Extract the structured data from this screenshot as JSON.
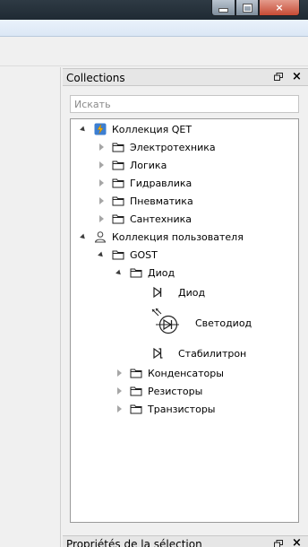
{
  "window": {
    "min_label": "",
    "max_label": "",
    "close_label": "×"
  },
  "collections_panel": {
    "title": "Collections",
    "close_label": "×",
    "search": {
      "placeholder": "Искать",
      "value": ""
    },
    "tree": {
      "qet": {
        "label": "Коллекция QET",
        "children": [
          "Электротехника",
          "Логика",
          "Гидравлика",
          "Пневматика",
          "Сантехника"
        ]
      },
      "user": {
        "label": "Коллекция пользователя",
        "gost": {
          "label": "GOST",
          "diode_folder": {
            "label": "Диод",
            "elements": [
              "Диод",
              "Светодиод",
              "Стабилитрон"
            ]
          },
          "folders": [
            "Конденсаторы",
            "Резисторы",
            "Транзисторы"
          ]
        }
      }
    }
  },
  "selection_panel": {
    "title": "Propriétés de la sélection",
    "close_label": "×"
  },
  "colors": {
    "qet_icon": "#f5b400",
    "accent_blue": "#3c7fd2"
  }
}
